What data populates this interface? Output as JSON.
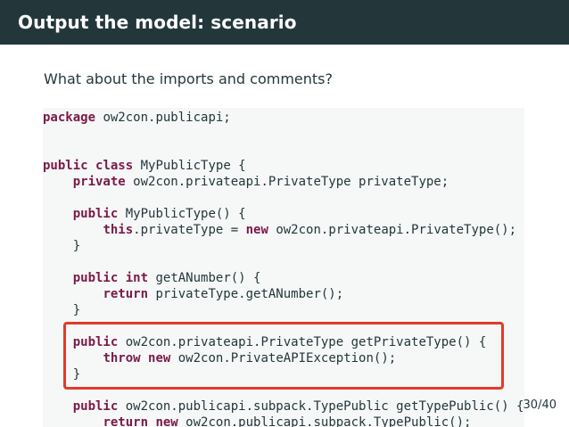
{
  "slide": {
    "title": "Output the model: scenario",
    "subtitle": "What about the imports and comments?",
    "page_number": "30/40"
  },
  "code": {
    "lines": [
      [
        {
          "t": "package",
          "k": true
        },
        {
          "t": " ow2con.publicapi;"
        }
      ],
      [],
      [],
      [
        {
          "t": "public",
          "k": true
        },
        {
          "t": " "
        },
        {
          "t": "class",
          "k": true
        },
        {
          "t": " MyPublicType {"
        }
      ],
      [
        {
          "t": "    "
        },
        {
          "t": "private",
          "k": true
        },
        {
          "t": " ow2con.privateapi.PrivateType privateType;"
        }
      ],
      [],
      [
        {
          "t": "    "
        },
        {
          "t": "public",
          "k": true
        },
        {
          "t": " MyPublicType() {"
        }
      ],
      [
        {
          "t": "        "
        },
        {
          "t": "this",
          "k": true
        },
        {
          "t": ".privateType = "
        },
        {
          "t": "new",
          "k": true
        },
        {
          "t": " ow2con.privateapi.PrivateType();"
        }
      ],
      [
        {
          "t": "    }"
        }
      ],
      [],
      [
        {
          "t": "    "
        },
        {
          "t": "public",
          "k": true
        },
        {
          "t": " "
        },
        {
          "t": "int",
          "k": true
        },
        {
          "t": " getANumber() {"
        }
      ],
      [
        {
          "t": "        "
        },
        {
          "t": "return",
          "k": true
        },
        {
          "t": " privateType.getANumber();"
        }
      ],
      [
        {
          "t": "    }"
        }
      ],
      [],
      [
        {
          "t": "    "
        },
        {
          "t": "public",
          "k": true
        },
        {
          "t": " ow2con.privateapi.PrivateType getPrivateType() {"
        }
      ],
      [
        {
          "t": "        "
        },
        {
          "t": "throw",
          "k": true
        },
        {
          "t": " "
        },
        {
          "t": "new",
          "k": true
        },
        {
          "t": " ow2con.PrivateAPIException();"
        }
      ],
      [
        {
          "t": "    }"
        }
      ],
      [],
      [
        {
          "t": "    "
        },
        {
          "t": "public",
          "k": true
        },
        {
          "t": " ow2con.publicapi.subpack.TypePublic getTypePublic() {"
        }
      ],
      [
        {
          "t": "        "
        },
        {
          "t": "return",
          "k": true
        },
        {
          "t": " "
        },
        {
          "t": "new",
          "k": true
        },
        {
          "t": " ow2con.publicapi.subpack.TypePublic();"
        }
      ]
    ]
  },
  "colors": {
    "title_bar": "#23373b",
    "keyword": "#7a1a4a",
    "highlight_border": "#e23a2a",
    "code_background": "#f6f7f7"
  }
}
